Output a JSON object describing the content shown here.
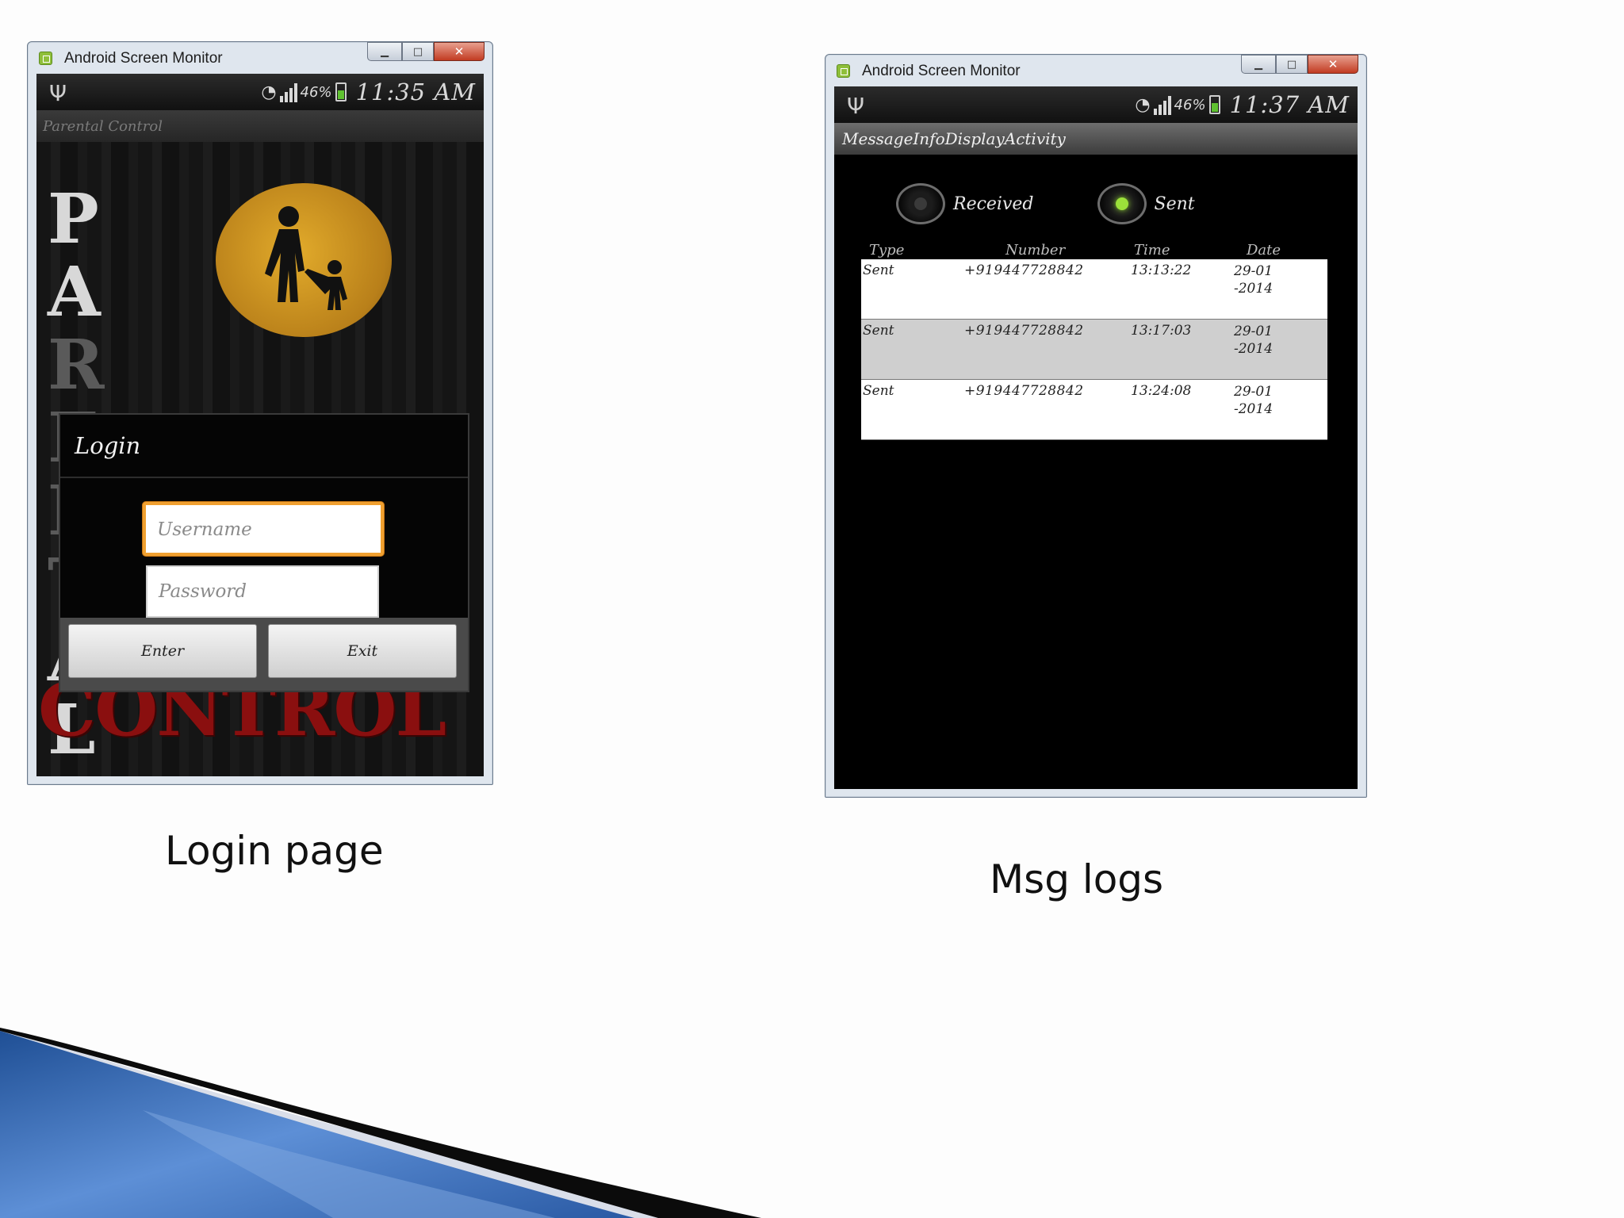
{
  "left_window": {
    "title": "Android Screen Monitor",
    "status": {
      "battery": "46%",
      "time": "11:35 AM"
    },
    "app_title": "Parental Control",
    "splash_letters": [
      "P",
      "A",
      "R",
      "E",
      "N",
      "T",
      "A",
      "L"
    ],
    "splash_word": "CONTROL",
    "dialog": {
      "title": "Login",
      "username_placeholder": "Username",
      "password_placeholder": "Password",
      "enter_label": "Enter",
      "exit_label": "Exit"
    }
  },
  "right_window": {
    "title": "Android Screen Monitor",
    "status": {
      "battery": "46%",
      "time": "11:37 AM"
    },
    "app_title": "MessageInfoDisplayActivity",
    "radios": [
      {
        "label": "Received",
        "checked": false
      },
      {
        "label": "Sent",
        "checked": true
      }
    ],
    "table": {
      "headers": [
        "Type",
        "Number",
        "Time",
        "Date"
      ],
      "rows": [
        [
          "Sent",
          "+919447728842",
          "13:13:22",
          "29-01\n-2014"
        ],
        [
          "Sent",
          "+919447728842",
          "13:17:03",
          "29-01\n-2014"
        ],
        [
          "Sent",
          "+919447728842",
          "13:24:08",
          "29-01\n-2014"
        ]
      ]
    }
  },
  "captions": {
    "login": "Login page",
    "msg": "Msg logs"
  },
  "colors": {
    "focus_accent": "#f0a030",
    "radio_checked": "#9be03a",
    "control_red": "#8a0f0f",
    "swoosh_blue": "#2f67b4"
  }
}
